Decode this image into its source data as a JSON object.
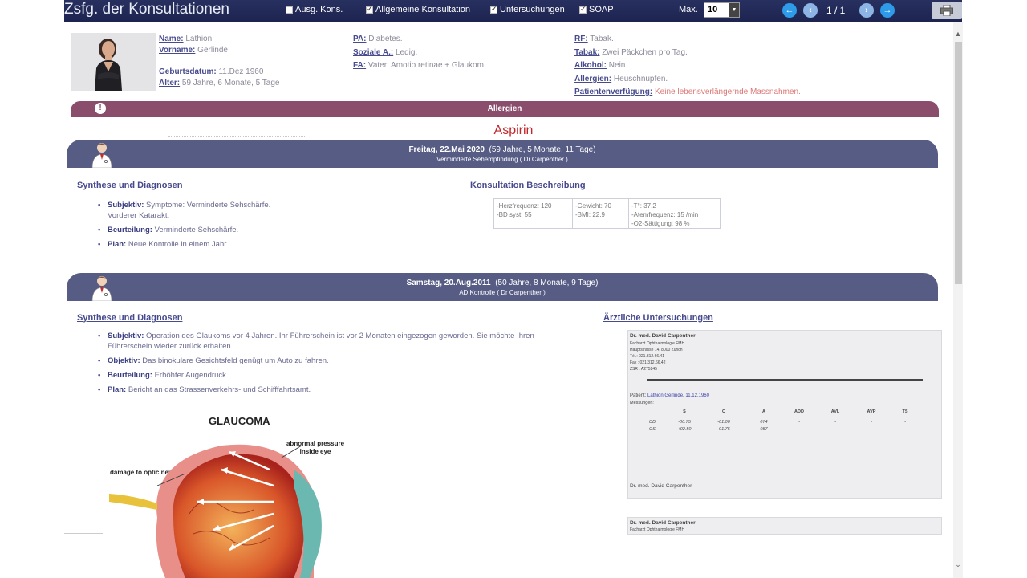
{
  "toolbar": {
    "title": "Zsfg. der Konsultationen",
    "filters": [
      {
        "label": "Ausg. Kons.",
        "checked": false
      },
      {
        "label": "Allgemeine Konsultation",
        "checked": true
      },
      {
        "label": "Untersuchungen",
        "checked": true
      },
      {
        "label": "SOAP",
        "checked": true
      }
    ],
    "max_label": "Max.",
    "max_value": "10",
    "pager": "1 / 1"
  },
  "patient": {
    "name_label": "Name:",
    "name": "Lathion",
    "vorname_label": "Vorname:",
    "vorname": "Gerlinde",
    "geburtsdatum_label": "Geburtsdatum:",
    "geburtsdatum": "11.Dez 1960",
    "alter_label": "Alter:",
    "alter": "59 Jahre, 6 Monate, 5 Tage",
    "pa_label": "PA:",
    "pa": "Diabetes.",
    "soziale_label": "Soziale A.:",
    "soziale": "Ledig.",
    "fa_label": "FA:",
    "fa": "Vater: Amotio retinae + Glaukom.",
    "rf_label": "RF:",
    "rf": "Tabak.",
    "tabak_label": "Tabak:",
    "tabak": "Zwei Päckchen pro Tag.",
    "alkohol_label": "Alkohol:",
    "alkohol": "Nein",
    "allergien_label": "Allergien:",
    "allergien": "Heuschnupfen.",
    "verfuegung_label": "Patientenverfügung:",
    "verfuegung": "Keine lebensverlängernde Massnahmen."
  },
  "allergy": {
    "bar_label": "Allergien",
    "value": "Aspirin"
  },
  "consultation1": {
    "date": "Freitag, 22.Mai 2020",
    "age": "(59 Jahre, 5 Monate, 11 Tage)",
    "subtitle": "Verminderte Sehempfindung  ( Dr.Carpenther )",
    "synthese_heading": "Synthese und Diagnosen",
    "beschreibung_heading": "Konsultation Beschreibung",
    "subjektiv_key": "Subjektiv:",
    "subjektiv": "Symptome: Verminderte Sehschärfe.",
    "subjektiv2": "Vorderer Katarakt.",
    "beurteilung_key": "Beurteilung:",
    "beurteilung": "Verminderte Sehschärfe.",
    "plan_key": "Plan:",
    "plan": "Neue Kontrolle in einem Jahr.",
    "vitals": {
      "c1a": "-Herzfrequenz:  120",
      "c1b": "-BD syst:  55",
      "c2a": "-Gewicht:  70",
      "c2b": "-BMI:  22.9",
      "c3a": "-T°:  37.2",
      "c3b": "-Atemfrequenz:  15 /min",
      "c3c": "-O2-Sättigung:  98 %"
    }
  },
  "consultation2": {
    "date": "Samstag, 20.Aug.2011",
    "age": "(50 Jahre, 8 Monate, 9 Tage)",
    "subtitle": "AD Kontrolle  ( Dr Carpenther )",
    "synthese_heading": "Synthese und Diagnosen",
    "untersuchungen_heading": "Ärztliche Untersuchungen",
    "subjektiv_key": "Subjektiv:",
    "subjektiv": "Operation des Glaukoms vor 4 Jahren. Ihr Führerschein ist vor 2 Monaten eingezogen geworden. Sie möchte Ihren",
    "subjektiv2": "Führerschein wieder zurück erhalten.",
    "objektiv_key": "Objektiv:",
    "objektiv": "Das binokulare Gesichtsfeld genügt um Auto zu fahren.",
    "beurteilung_key": "Beurteilung:",
    "beurteilung": "Erhöhter Augendruck.",
    "plan_key": "Plan:",
    "plan": "Bericht an das Strassenverkehrs- und Schifffahrtsamt."
  },
  "report": {
    "doctor": "Dr. med. David Carpenther",
    "address": "Facharzt Ophthalmologie FMH\nHauptstrasse 14, 8000 Zürich\nTél.: 021.312.66.41\nFax : 021.312.66.42\nZSR : A275245",
    "patient_label": "Patient:",
    "patient": "Lathion Gerlinde, 11.12.1960",
    "messungen": "Messungen:",
    "columns": [
      "S",
      "C",
      "A",
      "ADD",
      "AVL",
      "AVP",
      "TS"
    ],
    "rows": [
      {
        "eye": "OD",
        "vals": [
          "-00.75",
          "-01.00",
          "074",
          "-",
          "-",
          "-",
          "-"
        ]
      },
      {
        "eye": "OS",
        "vals": [
          "+02.50",
          "-01.75",
          "087",
          "-",
          "-",
          "-",
          "-"
        ]
      }
    ],
    "signature": "Dr. med. David Carpenther"
  },
  "report2": {
    "doctor": "Dr. med. David Carpenther",
    "address": "Facharzt Ophthalmologie FMH"
  },
  "glaucoma": {
    "title": "GLAUCOMA",
    "label_pressure": "abnormal pressure inside eye",
    "label_nerve": "damage to optic nerve"
  }
}
